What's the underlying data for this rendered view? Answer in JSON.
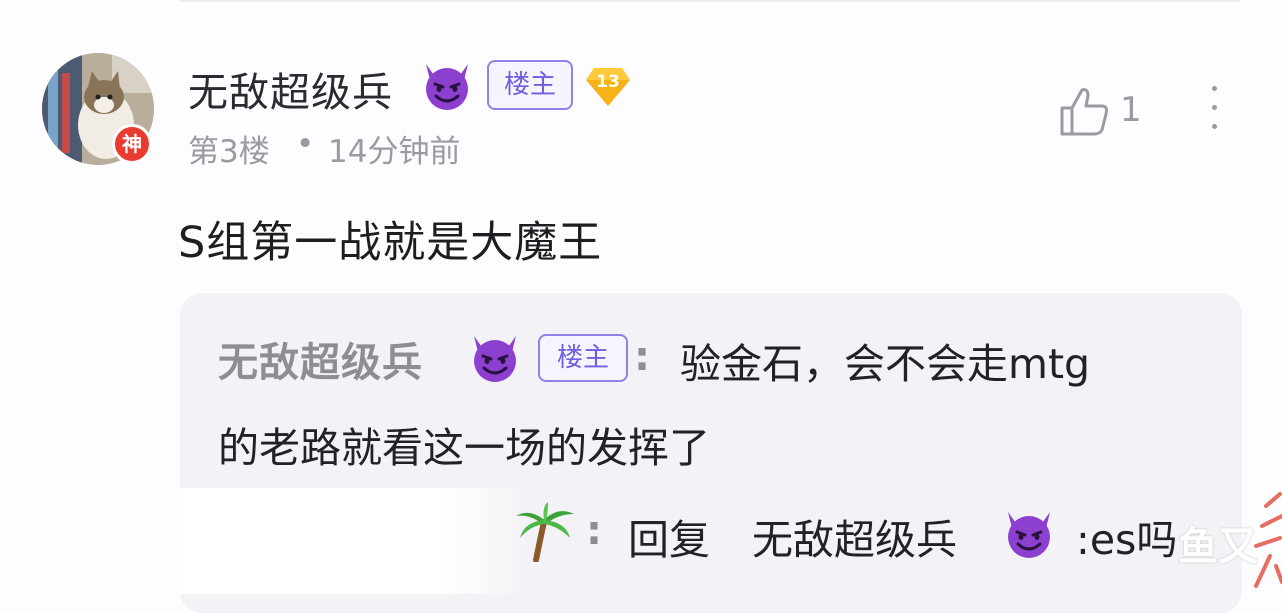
{
  "post": {
    "username": "无敌超级兵",
    "owner_badge": "楼主",
    "level": "13",
    "avatar_badge": "神",
    "floor": "第3楼",
    "separator": "•",
    "time": "14分钟前",
    "likes": "1",
    "content": "S组第一战就是大魔王"
  },
  "quote": {
    "username": "无敌超级兵",
    "owner_badge": "楼主",
    "colon": ":",
    "text_line1": "验金石，会不会走mtg",
    "text_line2": "的老路就看这一场的发挥了"
  },
  "reply": {
    "colon": ":",
    "verb": "回复",
    "target": "无敌超级兵",
    "tail": ":es吗"
  },
  "watermark": {
    "text": "鱼又"
  },
  "icons": {
    "like": "thumbs-up-icon",
    "more": "more-vertical-icon",
    "emoji": "smiling-devil-emoji-icon",
    "palm": "palm-tree-emoji-icon",
    "level": "level-diamond-icon"
  },
  "colors": {
    "owner_badge": "#6e5fe0",
    "level_badge": "#f6b317",
    "avatar_badge": "#ea3b30",
    "devil": "#8d3fd0",
    "quote_bg": "#f3f2f6"
  }
}
